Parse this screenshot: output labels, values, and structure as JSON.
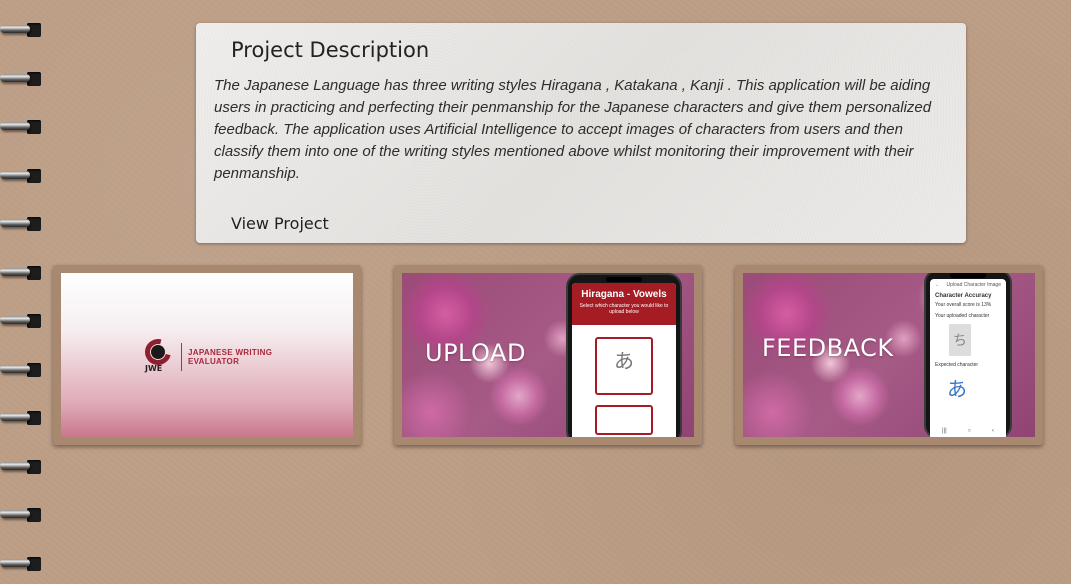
{
  "project": {
    "title": "Project Description",
    "description": "The Japanese Language has three writing styles Hiragana , Katakana , Kanji . This application will be aiding users in practicing and perfecting their penmanship for the Japanese characters and give them personalized feedback. The application uses Artificial Intelligence to accept images of characters from users and then classify them into one of the writing styles mentioned above whilst monitoring their improvement with their penmanship.",
    "view_label": "View Project"
  },
  "gallery": {
    "logo": {
      "mark_text": "JWE",
      "line1": "JAPANESE WRITING",
      "line2": "EVALUATOR"
    },
    "upload": {
      "label": "UPLOAD",
      "phone_title": "Hiragana - Vowels",
      "phone_subtitle": "Select which character you would like to upload below",
      "kana": "あ"
    },
    "feedback": {
      "label": "FEEDBACK",
      "screen_title": "Upload Character Image",
      "heading": "Character Accuracy",
      "score_line": "Your overall score is 13%",
      "uploaded_label": "Your uploaded character",
      "uploaded_kana": "ち",
      "expected_label": "Expected character",
      "expected_kana": "あ"
    }
  },
  "colors": {
    "background": "#bd9e86",
    "card_frame": "#a8896f",
    "accent_red": "#a51c24"
  }
}
